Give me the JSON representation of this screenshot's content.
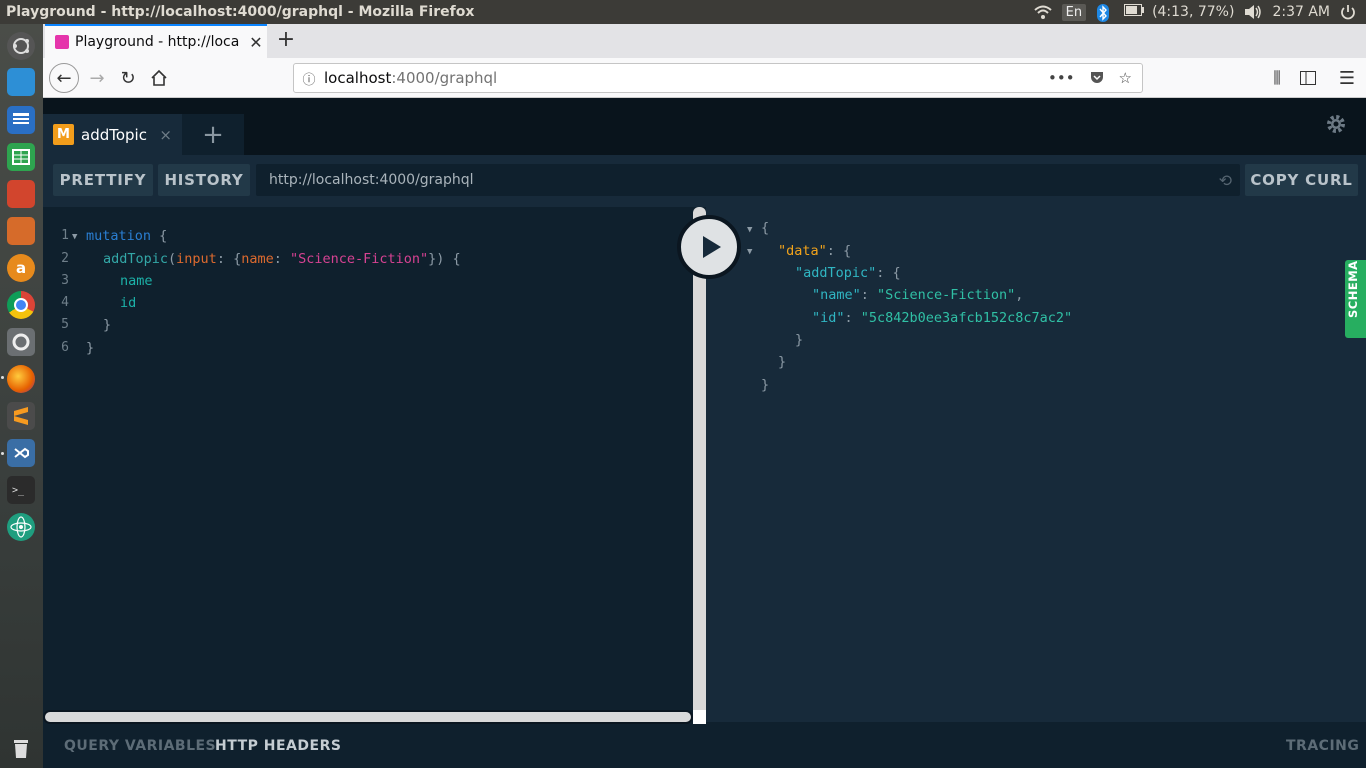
{
  "os": {
    "window_title": "Playground - http://localhost:4000/graphql - Mozilla Firefox",
    "keyboard": "En",
    "battery": "(4:13, 77%)",
    "time": "2:37 AM"
  },
  "launcher": {
    "items": [
      "ubuntu-dash",
      "files",
      "writer",
      "calc",
      "impress",
      "software-center",
      "amazon",
      "chrome",
      "system-settings",
      "firefox",
      "sublime-text",
      "vscode",
      "terminal",
      "atom",
      "trash"
    ]
  },
  "browser": {
    "tab_title": "Playground - http://loca",
    "new_tab": "+",
    "url_host": "localhost",
    "url_path": ":4000/graphql",
    "url_more": "•••"
  },
  "playground": {
    "tab": {
      "badge": "M",
      "label": "addTopic",
      "close": "×"
    },
    "new_tab": "+",
    "prettify": "PRETTIFY",
    "history": "HISTORY",
    "endpoint": "http://localhost:4000/graphql",
    "copy_curl": "COPY CURL",
    "schema": "SCHEMA",
    "query_variables": "QUERY VARIABLES",
    "http_headers": "HTTP HEADERS",
    "tracing": "TRACING"
  },
  "editor": {
    "line_numbers": [
      "1",
      "2",
      "3",
      "4",
      "5",
      "6"
    ],
    "keyword": "mutation",
    "field": "addTopic",
    "arg": "input",
    "arg_key": "name",
    "arg_value": "\"Science-Fiction\"",
    "selections": [
      "name",
      "id"
    ]
  },
  "result": {
    "data_key": "\"data\"",
    "op_key": "\"addTopic\"",
    "name_key": "\"name\"",
    "name_value": "\"Science-Fiction\"",
    "id_key": "\"id\"",
    "id_value": "\"5c842b0ee3afcb152c8c7ac2\""
  },
  "colors": {
    "accent_green": "#27ae60",
    "badge_orange": "#f29d1b",
    "bg_dark": "#0f202d",
    "bg_panel": "#172a3a"
  }
}
